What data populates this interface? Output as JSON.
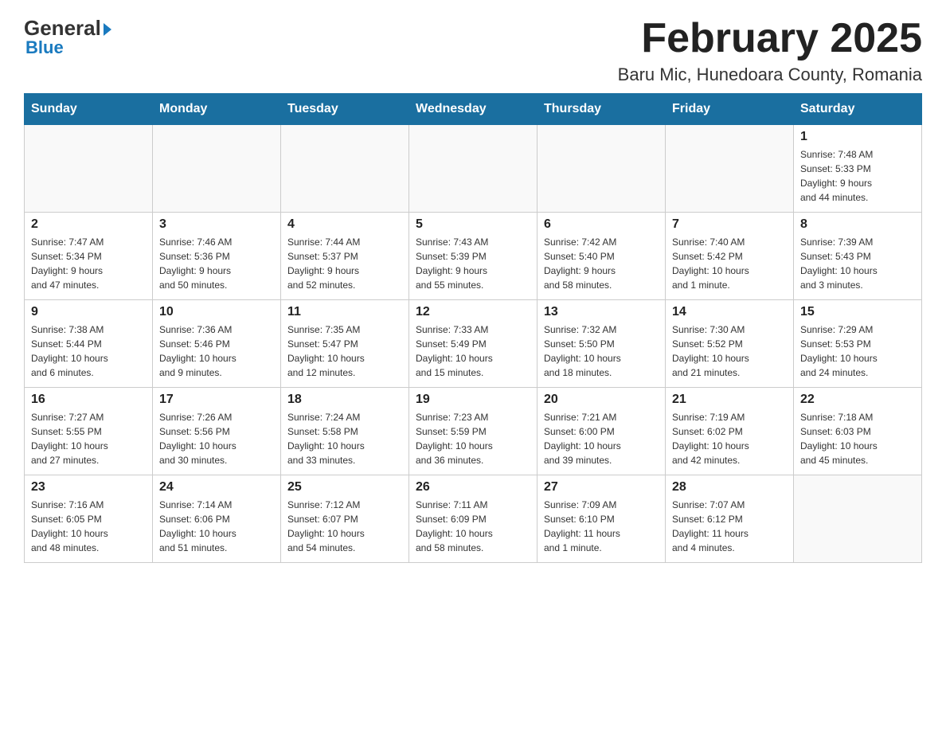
{
  "header": {
    "logo": {
      "general": "General",
      "blue": "Blue"
    },
    "title": "February 2025",
    "subtitle": "Baru Mic, Hunedoara County, Romania"
  },
  "days_of_week": [
    "Sunday",
    "Monday",
    "Tuesday",
    "Wednesday",
    "Thursday",
    "Friday",
    "Saturday"
  ],
  "weeks": [
    [
      {
        "day": "",
        "info": ""
      },
      {
        "day": "",
        "info": ""
      },
      {
        "day": "",
        "info": ""
      },
      {
        "day": "",
        "info": ""
      },
      {
        "day": "",
        "info": ""
      },
      {
        "day": "",
        "info": ""
      },
      {
        "day": "1",
        "info": "Sunrise: 7:48 AM\nSunset: 5:33 PM\nDaylight: 9 hours\nand 44 minutes."
      }
    ],
    [
      {
        "day": "2",
        "info": "Sunrise: 7:47 AM\nSunset: 5:34 PM\nDaylight: 9 hours\nand 47 minutes."
      },
      {
        "day": "3",
        "info": "Sunrise: 7:46 AM\nSunset: 5:36 PM\nDaylight: 9 hours\nand 50 minutes."
      },
      {
        "day": "4",
        "info": "Sunrise: 7:44 AM\nSunset: 5:37 PM\nDaylight: 9 hours\nand 52 minutes."
      },
      {
        "day": "5",
        "info": "Sunrise: 7:43 AM\nSunset: 5:39 PM\nDaylight: 9 hours\nand 55 minutes."
      },
      {
        "day": "6",
        "info": "Sunrise: 7:42 AM\nSunset: 5:40 PM\nDaylight: 9 hours\nand 58 minutes."
      },
      {
        "day": "7",
        "info": "Sunrise: 7:40 AM\nSunset: 5:42 PM\nDaylight: 10 hours\nand 1 minute."
      },
      {
        "day": "8",
        "info": "Sunrise: 7:39 AM\nSunset: 5:43 PM\nDaylight: 10 hours\nand 3 minutes."
      }
    ],
    [
      {
        "day": "9",
        "info": "Sunrise: 7:38 AM\nSunset: 5:44 PM\nDaylight: 10 hours\nand 6 minutes."
      },
      {
        "day": "10",
        "info": "Sunrise: 7:36 AM\nSunset: 5:46 PM\nDaylight: 10 hours\nand 9 minutes."
      },
      {
        "day": "11",
        "info": "Sunrise: 7:35 AM\nSunset: 5:47 PM\nDaylight: 10 hours\nand 12 minutes."
      },
      {
        "day": "12",
        "info": "Sunrise: 7:33 AM\nSunset: 5:49 PM\nDaylight: 10 hours\nand 15 minutes."
      },
      {
        "day": "13",
        "info": "Sunrise: 7:32 AM\nSunset: 5:50 PM\nDaylight: 10 hours\nand 18 minutes."
      },
      {
        "day": "14",
        "info": "Sunrise: 7:30 AM\nSunset: 5:52 PM\nDaylight: 10 hours\nand 21 minutes."
      },
      {
        "day": "15",
        "info": "Sunrise: 7:29 AM\nSunset: 5:53 PM\nDaylight: 10 hours\nand 24 minutes."
      }
    ],
    [
      {
        "day": "16",
        "info": "Sunrise: 7:27 AM\nSunset: 5:55 PM\nDaylight: 10 hours\nand 27 minutes."
      },
      {
        "day": "17",
        "info": "Sunrise: 7:26 AM\nSunset: 5:56 PM\nDaylight: 10 hours\nand 30 minutes."
      },
      {
        "day": "18",
        "info": "Sunrise: 7:24 AM\nSunset: 5:58 PM\nDaylight: 10 hours\nand 33 minutes."
      },
      {
        "day": "19",
        "info": "Sunrise: 7:23 AM\nSunset: 5:59 PM\nDaylight: 10 hours\nand 36 minutes."
      },
      {
        "day": "20",
        "info": "Sunrise: 7:21 AM\nSunset: 6:00 PM\nDaylight: 10 hours\nand 39 minutes."
      },
      {
        "day": "21",
        "info": "Sunrise: 7:19 AM\nSunset: 6:02 PM\nDaylight: 10 hours\nand 42 minutes."
      },
      {
        "day": "22",
        "info": "Sunrise: 7:18 AM\nSunset: 6:03 PM\nDaylight: 10 hours\nand 45 minutes."
      }
    ],
    [
      {
        "day": "23",
        "info": "Sunrise: 7:16 AM\nSunset: 6:05 PM\nDaylight: 10 hours\nand 48 minutes."
      },
      {
        "day": "24",
        "info": "Sunrise: 7:14 AM\nSunset: 6:06 PM\nDaylight: 10 hours\nand 51 minutes."
      },
      {
        "day": "25",
        "info": "Sunrise: 7:12 AM\nSunset: 6:07 PM\nDaylight: 10 hours\nand 54 minutes."
      },
      {
        "day": "26",
        "info": "Sunrise: 7:11 AM\nSunset: 6:09 PM\nDaylight: 10 hours\nand 58 minutes."
      },
      {
        "day": "27",
        "info": "Sunrise: 7:09 AM\nSunset: 6:10 PM\nDaylight: 11 hours\nand 1 minute."
      },
      {
        "day": "28",
        "info": "Sunrise: 7:07 AM\nSunset: 6:12 PM\nDaylight: 11 hours\nand 4 minutes."
      },
      {
        "day": "",
        "info": ""
      }
    ]
  ]
}
